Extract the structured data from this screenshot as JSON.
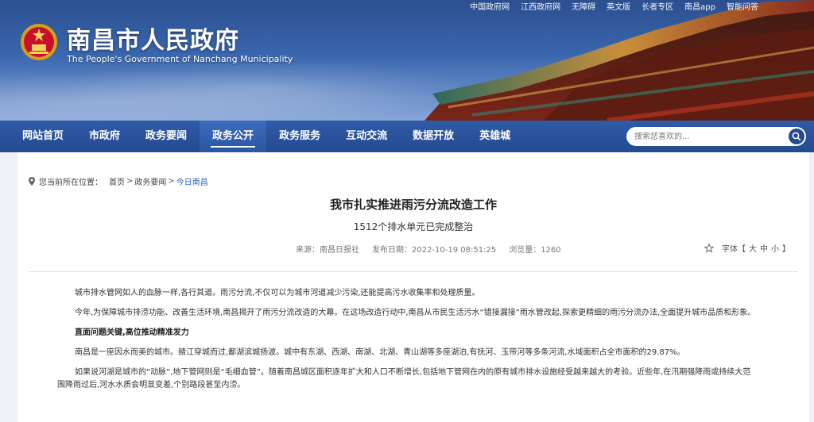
{
  "header": {
    "title": "南昌市人民政府",
    "subtitle": "The People's Government of Nanchang Municipality",
    "top_links": [
      "中国政府网",
      "江西政府网",
      "无障碍",
      "英文版",
      "长者专区",
      "南昌app",
      "智能问答"
    ]
  },
  "nav": {
    "items": [
      {
        "label": "网站首页"
      },
      {
        "label": "市政府"
      },
      {
        "label": "政务要闻"
      },
      {
        "label": "政务公开"
      },
      {
        "label": "政务服务"
      },
      {
        "label": "互动交流"
      },
      {
        "label": "数据开放"
      },
      {
        "label": "英雄城"
      }
    ],
    "active_index": 3,
    "search_placeholder": "搜索您喜欢的..."
  },
  "breadcrumb": {
    "prefix": "您当前所在位置：",
    "items": [
      "首页",
      "政务要闻",
      "今日南昌"
    ],
    "separator": ">"
  },
  "article": {
    "title": "我市扎实推进雨污分流改造工作",
    "subtitle": "1512个排水单元已完成整治",
    "source_label": "来源：南昌日报社",
    "time_label": "发布日期：2022-10-19 08:51:25",
    "views_label": "浏览量：1260",
    "font_label": "字体【",
    "font_sizes": [
      "大",
      "中",
      "小"
    ],
    "font_end": "】",
    "paragraphs": [
      {
        "text": "城市排水管网如人的血脉一样,各行其道。雨污分流,不仅可以为城市河道减少污染,还能提高污水收集率和处理质量。",
        "heading": false
      },
      {
        "text": "今年,为保障城市排涝功能、改善生活环境,南昌揭开了雨污分流改造的大幕。在这场改造行动中,南昌从市民生活污水“错接漏接”雨水管改起,探索更精细的雨污分流办法,全面提升城市品质和形象。",
        "heading": false
      },
      {
        "text": "直面问题关键,高位推动精准发力",
        "heading": true
      },
      {
        "text": "南昌是一座因水而美的城市。赣江穿城而过,鄱湖滨城扬波。城中有东湖、西湖、南湖、北湖、青山湖等多座湖泊,有抚河、玉带河等多条河流,水域面积占全市面积的29.87%。",
        "heading": false
      },
      {
        "text": "如果说河湖是城市的“动脉”,地下管网则是“毛细血管”。随着南昌城区面积逐年扩大和人口不断增长,包括地下管网在内的原有城市排水设施经受越来越大的考验。近些年,在汛期强降雨或持续大范围降雨过后,河水水质会明显变差,个别路段甚至内涝。",
        "heading": false
      }
    ]
  },
  "colors": {
    "nav_bg": "#244a8f",
    "link_blue": "#2a64c1",
    "page_bg": "#eef1f6"
  }
}
